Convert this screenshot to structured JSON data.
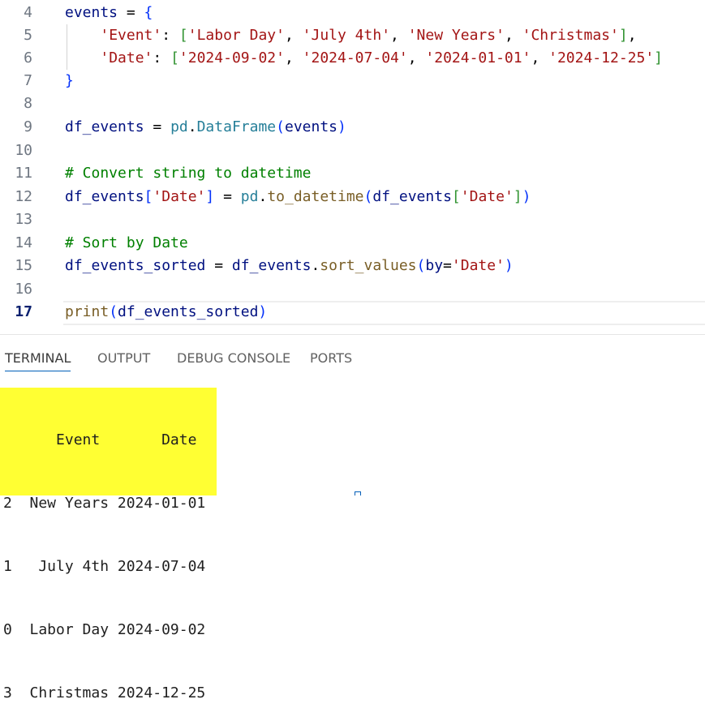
{
  "editor": {
    "lines": [
      {
        "num": "4",
        "tokens": [
          {
            "t": "events",
            "c": "t-var"
          },
          {
            "t": " = ",
            "c": "t-op"
          },
          {
            "t": "{",
            "c": "t-br1"
          }
        ]
      },
      {
        "num": "5",
        "tokens": [
          {
            "t": "    ",
            "c": "t-op"
          },
          {
            "t": "'Event'",
            "c": "t-str"
          },
          {
            "t": ": ",
            "c": "t-op"
          },
          {
            "t": "[",
            "c": "t-br2"
          },
          {
            "t": "'Labor Day'",
            "c": "t-str"
          },
          {
            "t": ", ",
            "c": "t-op"
          },
          {
            "t": "'July 4th'",
            "c": "t-str"
          },
          {
            "t": ", ",
            "c": "t-op"
          },
          {
            "t": "'New Years'",
            "c": "t-str"
          },
          {
            "t": ", ",
            "c": "t-op"
          },
          {
            "t": "'Christmas'",
            "c": "t-str"
          },
          {
            "t": "]",
            "c": "t-br2"
          },
          {
            "t": ",",
            "c": "t-op"
          }
        ]
      },
      {
        "num": "6",
        "tokens": [
          {
            "t": "    ",
            "c": "t-op"
          },
          {
            "t": "'Date'",
            "c": "t-str"
          },
          {
            "t": ": ",
            "c": "t-op"
          },
          {
            "t": "[",
            "c": "t-br2"
          },
          {
            "t": "'2024-09-02'",
            "c": "t-str"
          },
          {
            "t": ", ",
            "c": "t-op"
          },
          {
            "t": "'2024-07-04'",
            "c": "t-str"
          },
          {
            "t": ", ",
            "c": "t-op"
          },
          {
            "t": "'2024-01-01'",
            "c": "t-str"
          },
          {
            "t": ", ",
            "c": "t-op"
          },
          {
            "t": "'2024-12-25'",
            "c": "t-str"
          },
          {
            "t": "]",
            "c": "t-br2"
          }
        ]
      },
      {
        "num": "7",
        "tokens": [
          {
            "t": "}",
            "c": "t-br1"
          }
        ]
      },
      {
        "num": "8",
        "tokens": []
      },
      {
        "num": "9",
        "tokens": [
          {
            "t": "df_events",
            "c": "t-var"
          },
          {
            "t": " = ",
            "c": "t-op"
          },
          {
            "t": "pd",
            "c": "t-cls"
          },
          {
            "t": ".",
            "c": "t-op"
          },
          {
            "t": "DataFrame",
            "c": "t-cls"
          },
          {
            "t": "(",
            "c": "t-br1"
          },
          {
            "t": "events",
            "c": "t-var"
          },
          {
            "t": ")",
            "c": "t-br1"
          }
        ]
      },
      {
        "num": "10",
        "tokens": []
      },
      {
        "num": "11",
        "tokens": [
          {
            "t": "# Convert string to datetime",
            "c": "t-cm"
          }
        ]
      },
      {
        "num": "12",
        "tokens": [
          {
            "t": "df_events",
            "c": "t-var"
          },
          {
            "t": "[",
            "c": "t-br1"
          },
          {
            "t": "'Date'",
            "c": "t-str"
          },
          {
            "t": "]",
            "c": "t-br1"
          },
          {
            "t": " = ",
            "c": "t-op"
          },
          {
            "t": "pd",
            "c": "t-cls"
          },
          {
            "t": ".",
            "c": "t-op"
          },
          {
            "t": "to_datetime",
            "c": "t-fn"
          },
          {
            "t": "(",
            "c": "t-br1"
          },
          {
            "t": "df_events",
            "c": "t-var"
          },
          {
            "t": "[",
            "c": "t-br2"
          },
          {
            "t": "'Date'",
            "c": "t-str"
          },
          {
            "t": "]",
            "c": "t-br2"
          },
          {
            "t": ")",
            "c": "t-br1"
          }
        ]
      },
      {
        "num": "13",
        "tokens": []
      },
      {
        "num": "14",
        "tokens": [
          {
            "t": "# Sort by Date",
            "c": "t-cm"
          }
        ]
      },
      {
        "num": "15",
        "tokens": [
          {
            "t": "df_events_sorted",
            "c": "t-var"
          },
          {
            "t": " = ",
            "c": "t-op"
          },
          {
            "t": "df_events",
            "c": "t-var"
          },
          {
            "t": ".",
            "c": "t-op"
          },
          {
            "t": "sort_values",
            "c": "t-fn"
          },
          {
            "t": "(",
            "c": "t-br1"
          },
          {
            "t": "by",
            "c": "t-var"
          },
          {
            "t": "=",
            "c": "t-op"
          },
          {
            "t": "'Date'",
            "c": "t-str"
          },
          {
            "t": ")",
            "c": "t-br1"
          }
        ]
      },
      {
        "num": "16",
        "tokens": []
      },
      {
        "num": "17",
        "tokens": [
          {
            "t": "print",
            "c": "t-fn"
          },
          {
            "t": "(",
            "c": "t-br1"
          },
          {
            "t": "df_events_sorted",
            "c": "t-var"
          },
          {
            "t": ")",
            "c": "t-br1"
          }
        ]
      }
    ]
  },
  "panel": {
    "tabs": [
      {
        "label": "TERMINAL",
        "active": true
      },
      {
        "label": "OUTPUT",
        "active": false
      },
      {
        "label": "DEBUG CONSOLE",
        "active": false
      },
      {
        "label": "PORTS",
        "active": false
      }
    ]
  },
  "terminal": {
    "output_lines": [
      "      Event       Date",
      "2  New Years 2024-01-01",
      "1   July 4th 2024-07-04",
      "0  Labor Day 2024-09-02",
      "3  Christmas 2024-12-25"
    ]
  }
}
